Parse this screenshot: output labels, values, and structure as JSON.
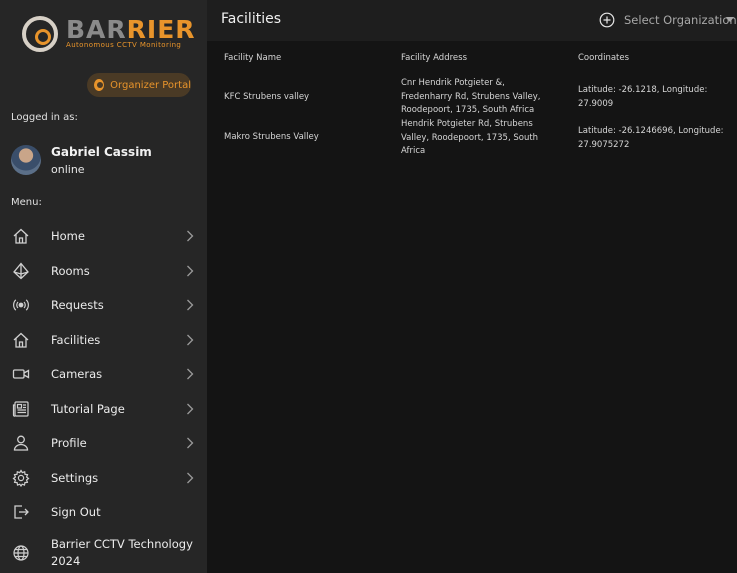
{
  "brand": {
    "name_part1": "BAR",
    "name_part2": "RIER",
    "tagline": "Autonomous CCTV Monitoring",
    "accent_color": "#e8942b"
  },
  "sidebar": {
    "portal_button": "Organizer Portal",
    "logged_in_label": "Logged in as:",
    "user_name": "Gabriel Cassim",
    "user_status": "online",
    "menu_label": "Menu:",
    "items": [
      {
        "label": "Home",
        "icon": "home-icon",
        "chevron": true
      },
      {
        "label": "Rooms",
        "icon": "rooms-icon",
        "chevron": true
      },
      {
        "label": "Requests",
        "icon": "broadcast-icon",
        "chevron": true
      },
      {
        "label": "Facilities",
        "icon": "home-icon",
        "chevron": true
      },
      {
        "label": "Cameras",
        "icon": "camera-icon",
        "chevron": true
      },
      {
        "label": "Tutorial Page",
        "icon": "newspaper-icon",
        "chevron": true
      },
      {
        "label": "Profile",
        "icon": "user-icon",
        "chevron": true
      },
      {
        "label": "Settings",
        "icon": "gear-icon",
        "chevron": true
      },
      {
        "label": "Sign Out",
        "icon": "sign-out-icon",
        "chevron": false
      }
    ],
    "footer_line1": "Barrier CCTV Technology",
    "footer_line2": "2024"
  },
  "header": {
    "title": "Facilities",
    "org_select_placeholder": "Select Organization"
  },
  "table": {
    "columns": [
      "Facility Name",
      "Facility Address",
      "Coordinates"
    ],
    "rows": [
      {
        "name": "KFC Strubens valley",
        "address": [
          "Cnr Hendrik Potgieter &,",
          "Fredenharry Rd, Strubens Valley,",
          "Roodepoort, 1735, South Africa"
        ],
        "coordinates": [
          "Latitude: -26.1218, Longitude:",
          "27.9009"
        ]
      },
      {
        "name": "Makro Strubens Valley",
        "address": [
          "Hendrik Potgieter Rd, Strubens",
          "Valley, Roodepoort, 1735, South",
          "Africa"
        ],
        "coordinates": [
          "Latitude: -26.1246696, Longitude:",
          "27.9075272"
        ]
      }
    ]
  }
}
